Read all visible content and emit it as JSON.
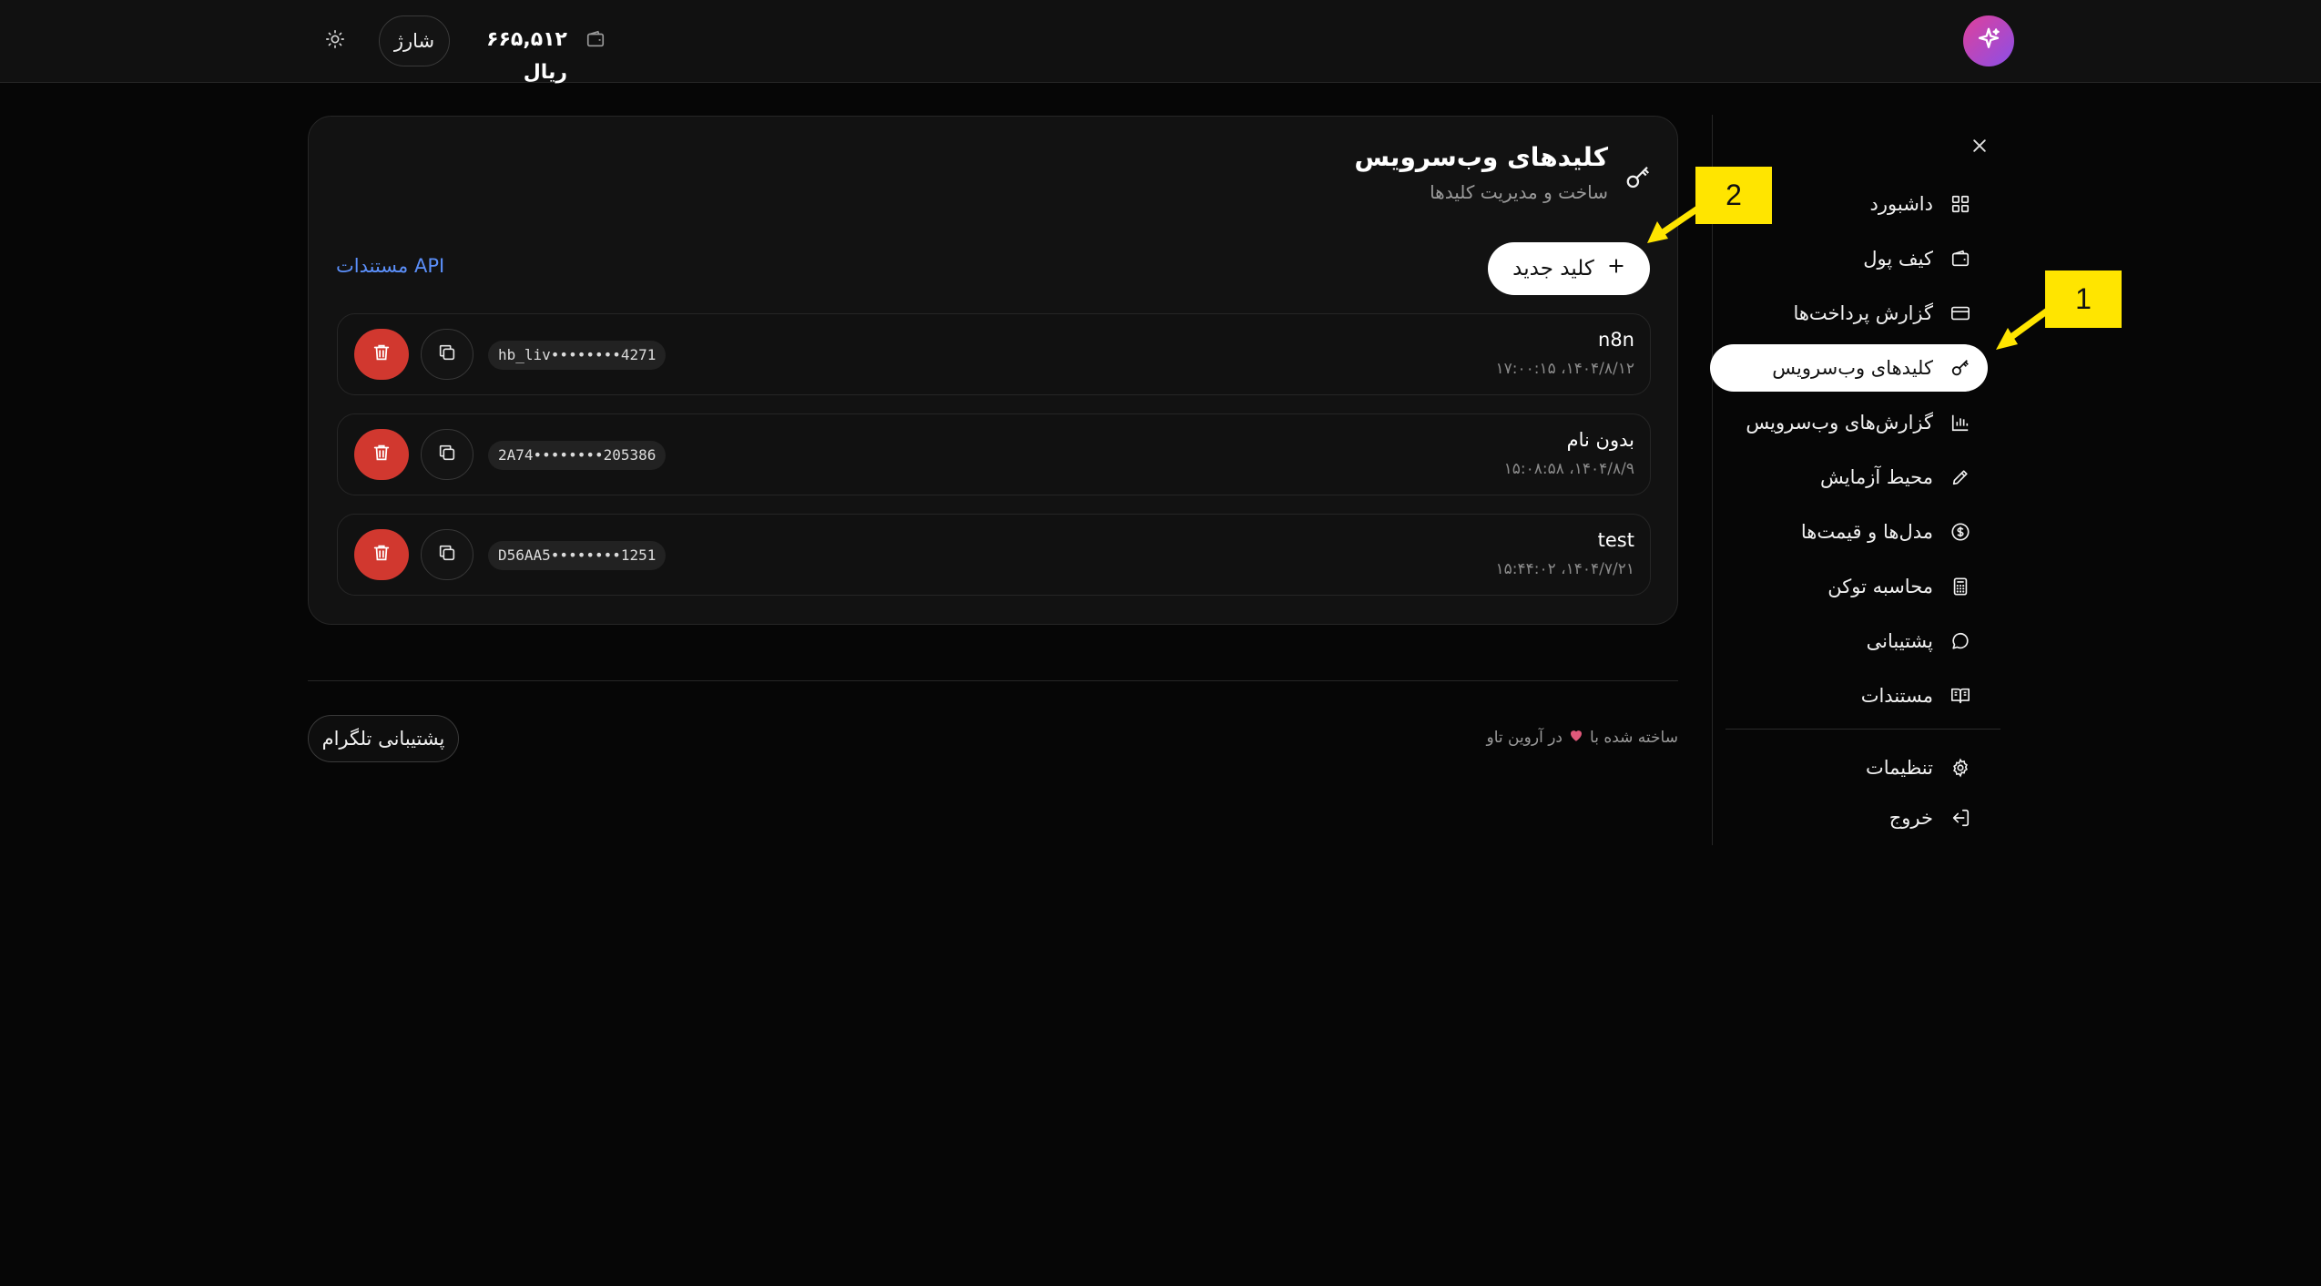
{
  "header": {
    "balance": "۶۶۵,۵۱۲ ریال",
    "charge_label": "شارژ"
  },
  "sidebar": {
    "items": [
      {
        "label": "داشبورد",
        "icon": "dashboard-grid-icon"
      },
      {
        "label": "کیف پول",
        "icon": "wallet-icon"
      },
      {
        "label": "گزارش پرداخت‌ها",
        "icon": "credit-card-icon"
      },
      {
        "label": "کلیدهای وب‌سرویس",
        "icon": "key-icon",
        "active": true
      },
      {
        "label": "گزارش‌های وب‌سرویس",
        "icon": "bar-chart-icon"
      },
      {
        "label": "محیط آزمایش",
        "icon": "pencil-icon"
      },
      {
        "label": "مدل‌ها و قیمت‌ها",
        "icon": "dollar-circle-icon"
      },
      {
        "label": "محاسبه توکن",
        "icon": "calculator-icon"
      },
      {
        "label": "پشتیبانی",
        "icon": "chat-bubble-icon"
      },
      {
        "label": "مستندات",
        "icon": "book-icon"
      }
    ],
    "bottom_items": [
      {
        "label": "تنظیمات",
        "icon": "gear-icon"
      },
      {
        "label": "خروج",
        "icon": "logout-icon"
      }
    ]
  },
  "main": {
    "title": "کلیدهای وب‌سرویس",
    "subtitle": "ساخت و مدیریت کلیدها",
    "new_key_label": "کلید جدید",
    "api_docs_label": "مستندات API",
    "keys": [
      {
        "name": "n8n",
        "date": "۱۴۰۴/۸/۱۲، ۱۷:۰۰:۱۵",
        "masked": "hb_liv••••••••4271"
      },
      {
        "name": "بدون نام",
        "date": "۱۴۰۴/۸/۹، ۱۵:۰۸:۵۸",
        "masked": "2A74••••••••205386"
      },
      {
        "name": "test",
        "date": "۱۴۰۴/۷/۲۱، ۱۵:۴۴:۰۲",
        "masked": "D56AA5••••••••1251"
      }
    ]
  },
  "footer": {
    "made_with_prefix": "ساخته شده با",
    "made_with_suffix": "در آروین تاو",
    "telegram_label": "پشتیبانی تلگرام"
  },
  "annotations": {
    "callout_1": "1",
    "callout_2": "2"
  },
  "colors": {
    "background": "#060606",
    "danger": "#d1382f",
    "link": "#5b8ff9",
    "callout": "#ffe500"
  }
}
